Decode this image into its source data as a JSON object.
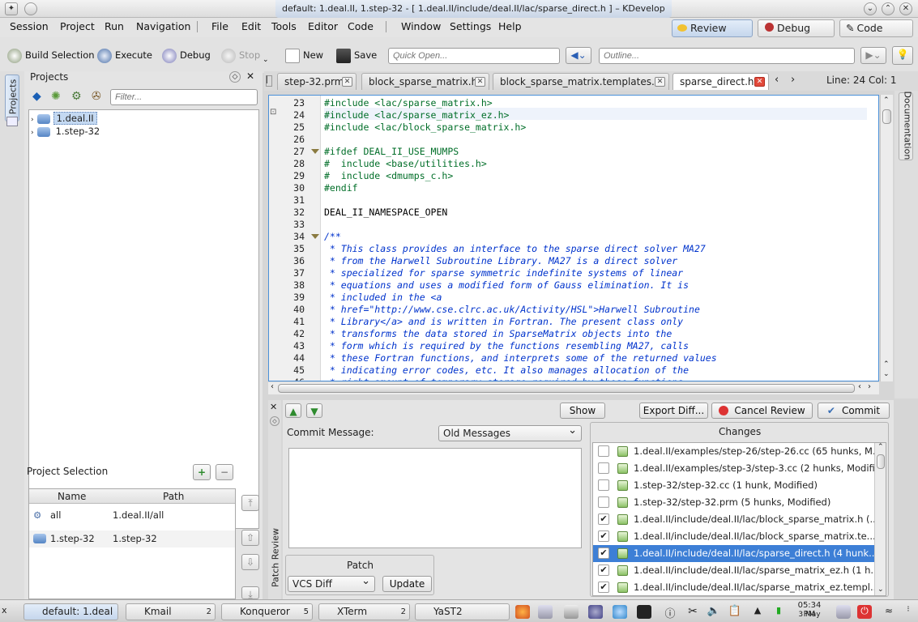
{
  "window": {
    "title": "default:  1.deal.II, 1.step-32 - [ 1.deal.II/include/deal.II/lac/sparse_direct.h ] – KDevelop"
  },
  "menubar": {
    "items": [
      "Session",
      "Project",
      "Run",
      "Navigation",
      "File",
      "Edit",
      "Tools",
      "Editor",
      "Code",
      "Window",
      "Settings",
      "Help"
    ]
  },
  "areas": {
    "review": "Review",
    "debug": "Debug",
    "code": "Code"
  },
  "toolbar": {
    "build": "Build Selection",
    "execute": "Execute",
    "debug": "Debug",
    "stop": "Stop",
    "new": "New",
    "save": "Save",
    "quick_open_placeholder": "Quick Open...",
    "outline_placeholder": "Outline..."
  },
  "projects": {
    "side_tab": "Projects",
    "title": "Projects",
    "filter_placeholder": "Filter...",
    "items": [
      "1.deal.II",
      "1.step-32"
    ]
  },
  "selection": {
    "title": "Project Selection",
    "col_name": "Name",
    "col_path": "Path",
    "rows": [
      {
        "name": "all",
        "path": "1.deal.II/all"
      },
      {
        "name": "1.step-32",
        "path": "1.step-32"
      }
    ]
  },
  "tabs": [
    "step-32.prm",
    "block_sparse_matrix.h",
    "block_sparse_matrix.templates.h",
    "sparse_direct.h"
  ],
  "cursor": "Line: 24 Col: 1",
  "documentation_tab": "Documentation",
  "code": {
    "lines": [
      {
        "n": "23",
        "t": "#include <lac/sparse_matrix.h>",
        "k": "pp"
      },
      {
        "n": "24",
        "t": "#include <lac/sparse_matrix_ez.h>",
        "k": "pp"
      },
      {
        "n": "25",
        "t": "#include <lac/block_sparse_matrix.h>",
        "k": "pp"
      },
      {
        "n": "26",
        "t": "",
        "k": ""
      },
      {
        "n": "27",
        "t": "#ifdef DEAL_II_USE_MUMPS",
        "k": "pp"
      },
      {
        "n": "28",
        "t": "#  include <base/utilities.h>",
        "k": "pp"
      },
      {
        "n": "29",
        "t": "#  include <dmumps_c.h>",
        "k": "pp"
      },
      {
        "n": "30",
        "t": "#endif",
        "k": "pp"
      },
      {
        "n": "31",
        "t": "",
        "k": ""
      },
      {
        "n": "32",
        "t": "DEAL_II_NAMESPACE_OPEN",
        "k": ""
      },
      {
        "n": "33",
        "t": "",
        "k": ""
      },
      {
        "n": "34",
        "t": "/**",
        "k": "cm"
      },
      {
        "n": "35",
        "t": " * This class provides an interface to the sparse direct solver MA27",
        "k": "cm"
      },
      {
        "n": "36",
        "t": " * from the Harwell Subroutine Library. MA27 is a direct solver",
        "k": "cm"
      },
      {
        "n": "37",
        "t": " * specialized for sparse symmetric indefinite systems of linear",
        "k": "cm"
      },
      {
        "n": "38",
        "t": " * equations and uses a modified form of Gauss elimination. It is",
        "k": "cm"
      },
      {
        "n": "39",
        "t": " * included in the <a",
        "k": "cm"
      },
      {
        "n": "40",
        "t": " * href=\"http://www.cse.clrc.ac.uk/Activity/HSL\">Harwell Subroutine",
        "k": "cm"
      },
      {
        "n": "41",
        "t": " * Library</a> and is written in Fortran. The present class only",
        "k": "cm"
      },
      {
        "n": "42",
        "t": " * transforms the data stored in SparseMatrix objects into the",
        "k": "cm"
      },
      {
        "n": "43",
        "t": " * form which is required by the functions resembling MA27, calls",
        "k": "cm"
      },
      {
        "n": "44",
        "t": " * these Fortran functions, and interprets some of the returned values",
        "k": "cm"
      },
      {
        "n": "45",
        "t": " * indicating error codes, etc. It also manages allocation of the",
        "k": "cm"
      },
      {
        "n": "46",
        "t": " * right amount of temporary storage required by these functions",
        "k": "cm"
      }
    ]
  },
  "review": {
    "side_tab": "Patch Review",
    "show": "Show",
    "export": "Export Diff...",
    "cancel": "Cancel Review",
    "commit": "Commit",
    "commit_label": "Commit Message:",
    "old_messages": "Old Messages",
    "patch_title": "Patch",
    "patch_type": "VCS Diff",
    "update": "Update",
    "changes_title": "Changes",
    "changes": [
      {
        "text": "1.deal.II/examples/step-26/step-26.cc (65 hunks, M...",
        "checked": false
      },
      {
        "text": "1.deal.II/examples/step-3/step-3.cc (2 hunks, Modifi...",
        "checked": false
      },
      {
        "text": "1.step-32/step-32.cc (1 hunk, Modified)",
        "checked": false
      },
      {
        "text": "1.step-32/step-32.prm (5 hunks, Modified)",
        "checked": false
      },
      {
        "text": "1.deal.II/include/deal.II/lac/block_sparse_matrix.h (...",
        "checked": true
      },
      {
        "text": "1.deal.II/include/deal.II/lac/block_sparse_matrix.te...",
        "checked": true
      },
      {
        "text": "1.deal.II/include/deal.II/lac/sparse_direct.h (4 hunk...",
        "checked": true
      },
      {
        "text": "1.deal.II/include/deal.II/lac/sparse_matrix_ez.h (1 h...",
        "checked": true
      },
      {
        "text": "1.deal.II/include/deal.II/lac/sparse_matrix_ez.templ...",
        "checked": true
      }
    ]
  },
  "taskbar": {
    "items": [
      {
        "label": "default: 1.deal",
        "num": ""
      },
      {
        "label": "Kmail",
        "num": "2"
      },
      {
        "label": "Konqueror",
        "num": "5"
      },
      {
        "label": "XTerm",
        "num": "2"
      },
      {
        "label": "YaST2",
        "num": ""
      }
    ],
    "clock_time": "05:34 PM",
    "clock_date": "3 May"
  },
  "colors": {
    "accent": "#4a90d9",
    "selection": "#3d7fd6",
    "comment": "#0033cc",
    "preprocessor": "#006e28"
  }
}
